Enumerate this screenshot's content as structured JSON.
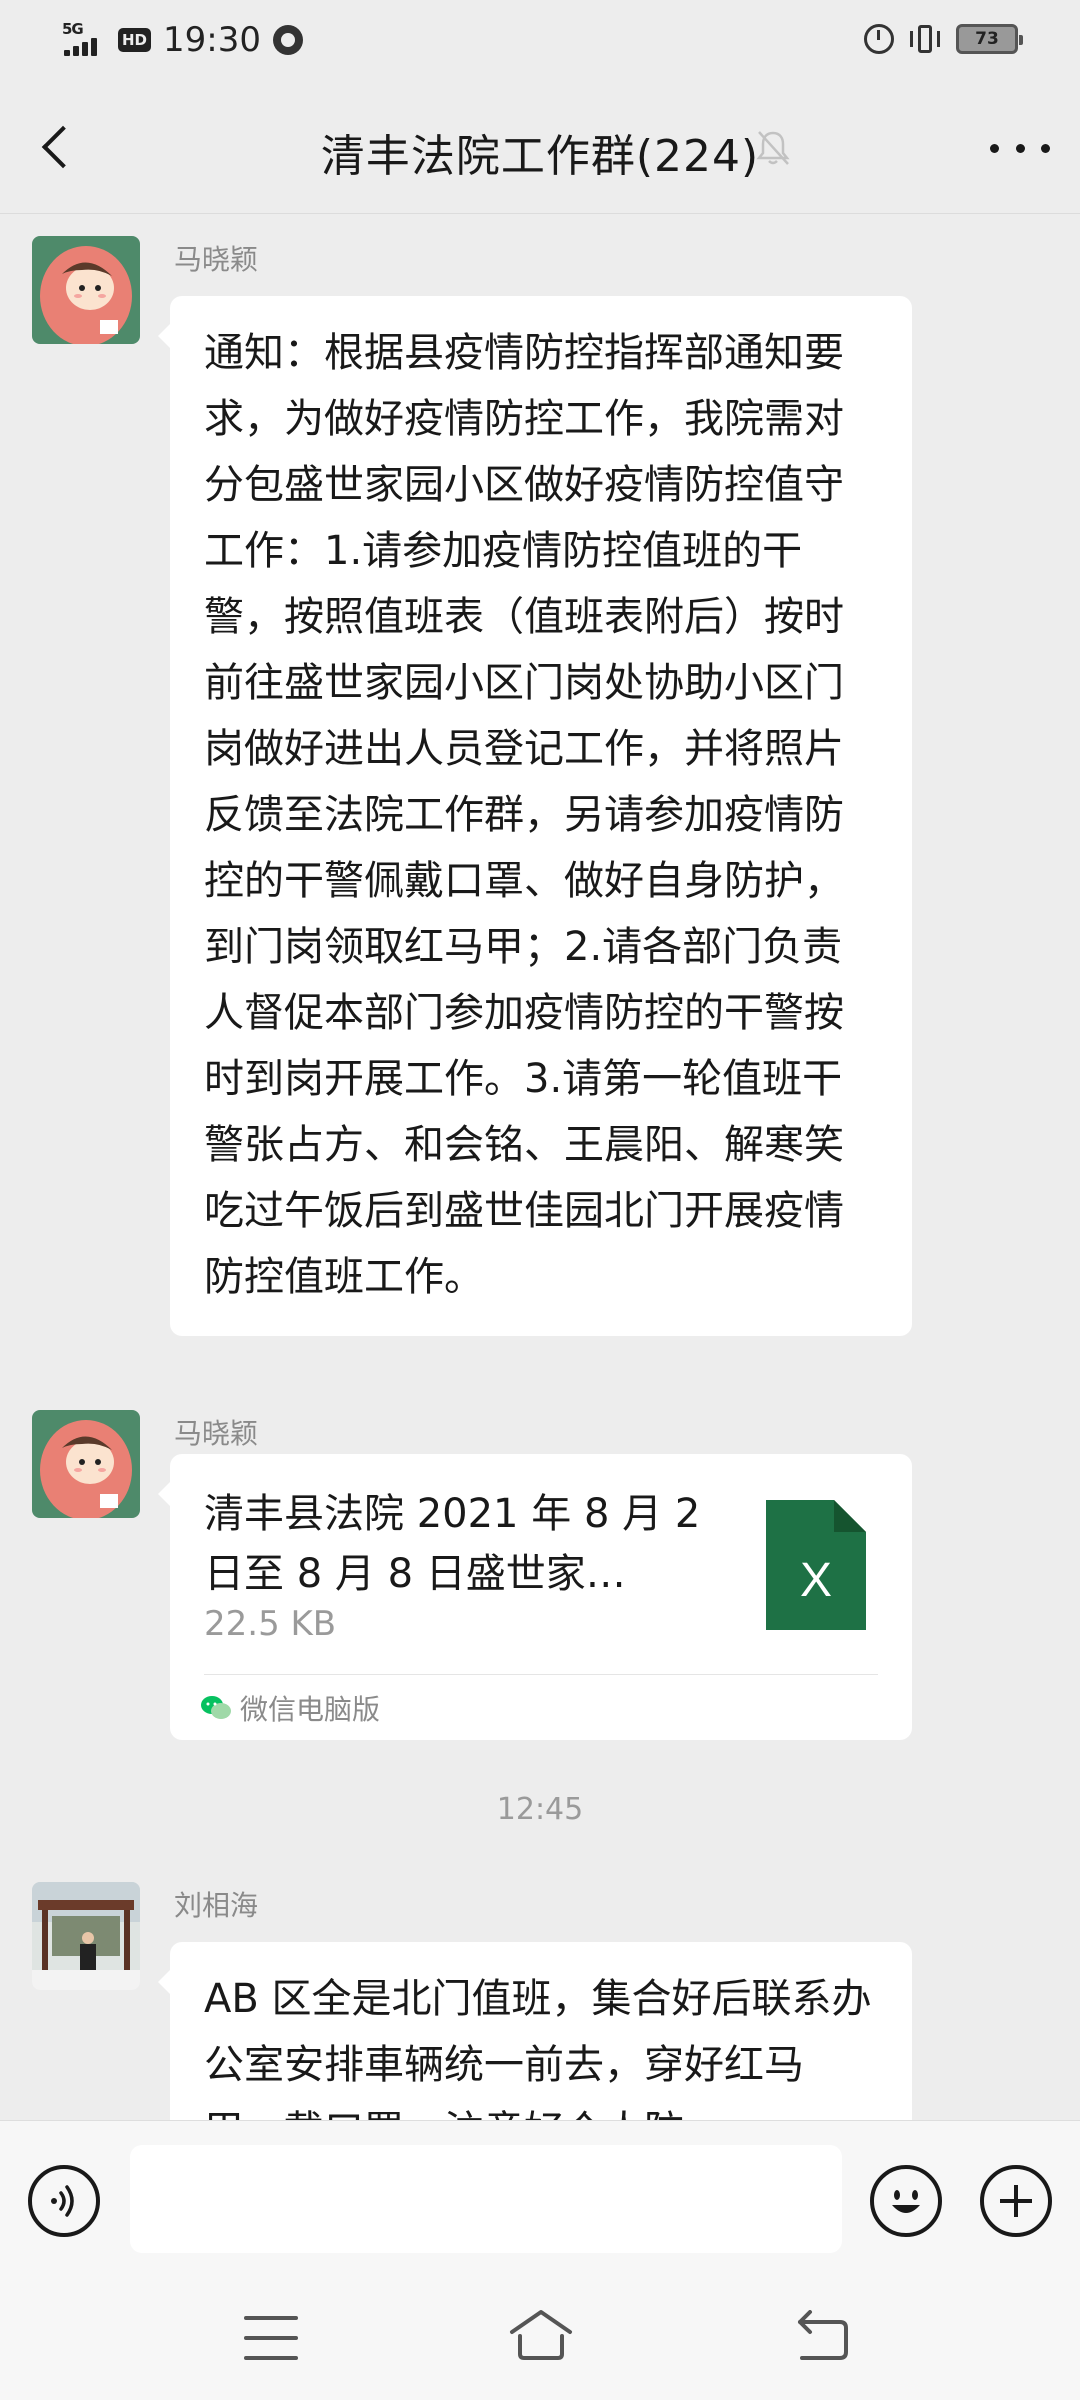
{
  "status_bar": {
    "network": "5G",
    "hd": "HD",
    "time": "19:30",
    "battery": "73",
    "icons": [
      "signal-icon",
      "app-notification-icon",
      "alarm-icon",
      "vibrate-icon",
      "battery-icon"
    ]
  },
  "header": {
    "title": "清丰法院工作群(224)",
    "icons": [
      "back-icon",
      "mute-icon",
      "more-icon"
    ]
  },
  "messages": [
    {
      "sender": "马晓颖",
      "type": "text",
      "text": "通知：根据县疫情防控指挥部通知要求，为做好疫情防控工作，我院需对分包盛世家园小区做好疫情防控值守工作：1.请参加疫情防控值班的干警，按照值班表（值班表附后）按时前往盛世家园小区门岗处协助小区门岗做好进出人员登记工作，并将照片反馈至法院工作群，另请参加疫情防控的干警佩戴口罩、做好自身防护，到门岗领取红马甲；2.请各部门负责人督促本部门参加疫情防控的干警按时到岗开展工作。3.请第一轮值班干警张占方、和会铭、王晨阳、解寒笑吃过午饭后到盛世佳园北门开展疫情防控值班工作。"
    },
    {
      "sender": "马晓颖",
      "type": "file",
      "file_name": "清丰县法院 2021 年 8 月 2 日至 8 月 8 日盛世家…",
      "file_size": "22.5 KB",
      "file_icon_letter": "X",
      "source": "微信电脑版"
    },
    {
      "type": "time",
      "text": "12:45"
    },
    {
      "sender": "刘相海",
      "type": "text",
      "text": "AB 区全是北门值班，集合好后联系办公室安排車辆统一前去，穿好红马甲，戴口罩，注意好个人防"
    }
  ],
  "input_bar": {
    "placeholder": "",
    "icons": [
      "voice-icon",
      "emoji-icon",
      "plus-icon"
    ]
  },
  "nav_bar": {
    "icons": [
      "menu-icon",
      "home-icon",
      "back-nav-icon"
    ]
  },
  "colors": {
    "background": "#ededed",
    "bubble": "#ffffff",
    "excel_green": "#1e7145",
    "wechat_green": "#07c160"
  }
}
